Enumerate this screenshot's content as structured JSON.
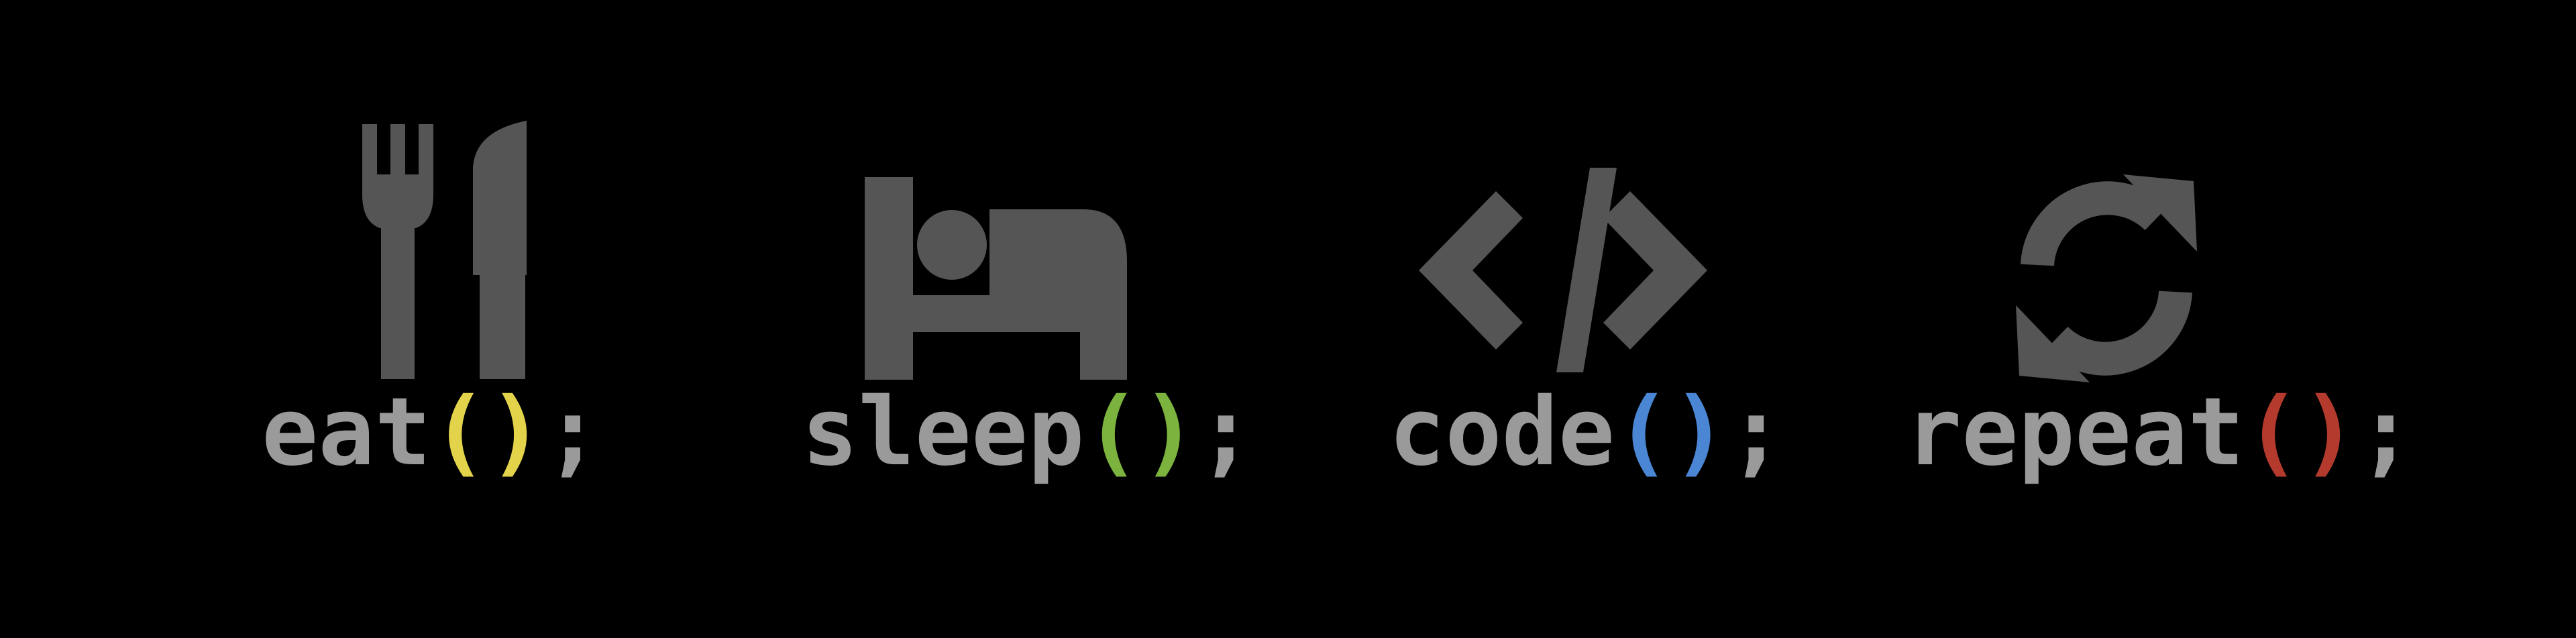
{
  "items": [
    {
      "icon": "fork-knife-icon",
      "word": "eat",
      "open": "(",
      "close": ")",
      "semi": ";",
      "paren_color": "#e3d34b"
    },
    {
      "icon": "bed-icon",
      "word": "sleep",
      "open": "(",
      "close": ")",
      "semi": ";",
      "paren_color": "#7bb33e"
    },
    {
      "icon": "code-icon",
      "word": "code",
      "open": "(",
      "close": ")",
      "semi": ";",
      "paren_color": "#4a86d4"
    },
    {
      "icon": "refresh-icon",
      "word": "repeat",
      "open": "(",
      "close": ")",
      "semi": ";",
      "paren_color": "#b33a2c"
    }
  ],
  "icon_color": "#555555",
  "text_color": "#9a9a9a"
}
